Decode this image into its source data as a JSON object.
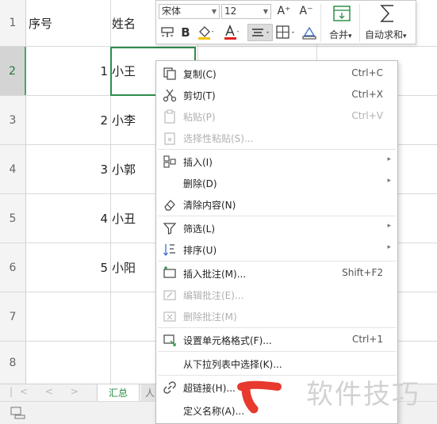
{
  "sheet": {
    "rows": [
      {
        "num": "1",
        "a": "序号",
        "b": "姓名"
      },
      {
        "num": "2",
        "a": "1",
        "b": "小王"
      },
      {
        "num": "3",
        "a": "2",
        "b": "小李"
      },
      {
        "num": "4",
        "a": "3",
        "b": "小郭"
      },
      {
        "num": "5",
        "a": "4",
        "b": "小丑"
      },
      {
        "num": "6",
        "a": "5",
        "b": "小阳"
      },
      {
        "num": "7",
        "a": "",
        "b": ""
      },
      {
        "num": "8",
        "a": "",
        "b": ""
      }
    ],
    "selected_row": "2",
    "accent_color": "#2e8b4e"
  },
  "tabs": {
    "nav_arrows": "|<  <  >  >|",
    "active": "汇总",
    "other": "人"
  },
  "mini_toolbar": {
    "font_name": "宋体",
    "font_size": "12",
    "grow_font_icon": "A⁺",
    "shrink_font_icon": "A⁻",
    "bold": "B",
    "merge_label": "合并",
    "merge_arrow": "▾",
    "autosum_label": "自动求和",
    "autosum_arrow": "▾",
    "icons": [
      "format-painter-icon",
      "fill-color-icon",
      "font-color-icon",
      "align-center-icon",
      "borders-icon",
      "clear-icon",
      "merge-icon",
      "sigma-icon"
    ]
  },
  "context_menu": {
    "items": [
      {
        "label": "复制(C)",
        "shortcut": "Ctrl+C",
        "icon": "copy-icon",
        "disabled": false
      },
      {
        "label": "剪切(T)",
        "shortcut": "Ctrl+X",
        "icon": "cut-icon",
        "disabled": false
      },
      {
        "label": "粘贴(P)",
        "shortcut": "Ctrl+V",
        "icon": "paste-icon",
        "disabled": true
      },
      {
        "label": "选择性粘贴(S)...",
        "shortcut": "",
        "icon": "paste-special-icon",
        "disabled": true
      },
      {
        "label": "插入(I)",
        "shortcut": "",
        "icon": "insert-icon",
        "disabled": false,
        "submenu": true
      },
      {
        "label": "删除(D)",
        "shortcut": "",
        "icon": "",
        "disabled": false,
        "submenu": true
      },
      {
        "label": "清除内容(N)",
        "shortcut": "",
        "icon": "eraser-icon",
        "disabled": false
      },
      {
        "label": "筛选(L)",
        "shortcut": "",
        "icon": "filter-icon",
        "disabled": false,
        "submenu": true
      },
      {
        "label": "排序(U)",
        "shortcut": "",
        "icon": "sort-icon",
        "disabled": false,
        "submenu": true
      },
      {
        "label": "插入批注(M)...",
        "shortcut": "Shift+F2",
        "icon": "insert-comment-icon",
        "disabled": false
      },
      {
        "label": "编辑批注(E)...",
        "shortcut": "",
        "icon": "edit-comment-icon",
        "disabled": true
      },
      {
        "label": "删除批注(M)",
        "shortcut": "",
        "icon": "delete-comment-icon",
        "disabled": true
      },
      {
        "label": "设置单元格格式(F)...",
        "shortcut": "Ctrl+1",
        "icon": "format-cells-icon",
        "disabled": false
      },
      {
        "label": "从下拉列表中选择(K)...",
        "shortcut": "",
        "icon": "",
        "disabled": false
      },
      {
        "label": "超链接(H)...",
        "shortcut": "",
        "icon": "hyperlink-icon",
        "disabled": false
      },
      {
        "label": "定义名称(A)...",
        "shortcut": "",
        "icon": "",
        "disabled": false
      }
    ],
    "submenu_arrow": "▸"
  },
  "watermark": "软件技巧",
  "annotation_color": "#e8392f"
}
